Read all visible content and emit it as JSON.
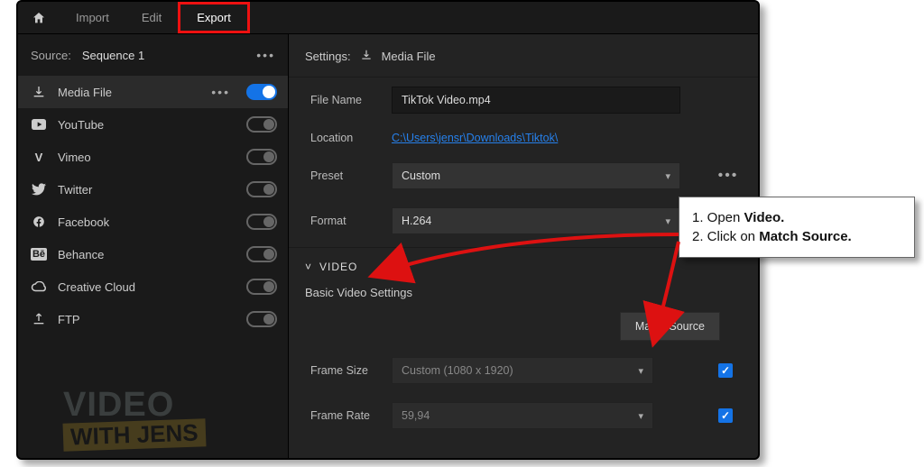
{
  "tabs": {
    "import": "Import",
    "edit": "Edit",
    "export": "Export"
  },
  "source": {
    "label": "Source:",
    "value": "Sequence 1"
  },
  "destinations": [
    {
      "label": "Media File",
      "on": true,
      "selected": true,
      "showDots": true
    },
    {
      "label": "YouTube",
      "on": false
    },
    {
      "label": "Vimeo",
      "on": false
    },
    {
      "label": "Twitter",
      "on": false
    },
    {
      "label": "Facebook",
      "on": false
    },
    {
      "label": "Behance",
      "on": false
    },
    {
      "label": "Creative Cloud",
      "on": false
    },
    {
      "label": "FTP",
      "on": false
    }
  ],
  "watermark": {
    "line1": "VIDEO",
    "line2": "WITH JENS"
  },
  "settings": {
    "title": "Settings:",
    "target": "Media File",
    "fileNameLabel": "File Name",
    "fileName": "TikTok Video.mp4",
    "locationLabel": "Location",
    "location": "C:\\Users\\jensr\\Downloads\\Tiktok\\",
    "presetLabel": "Preset",
    "preset": "Custom",
    "formatLabel": "Format",
    "format": "H.264"
  },
  "video": {
    "sectionTitle": "VIDEO",
    "subTitle": "Basic Video Settings",
    "matchSource": "Match Source",
    "frameSizeLabel": "Frame Size",
    "frameSize": "Custom (1080 x 1920)",
    "frameRateLabel": "Frame Rate",
    "frameRate": "59,94"
  },
  "callout": {
    "line1a": "1. Open ",
    "line1b": "Video.",
    "line2a": "2. Click on ",
    "line2b": "Match Source."
  }
}
